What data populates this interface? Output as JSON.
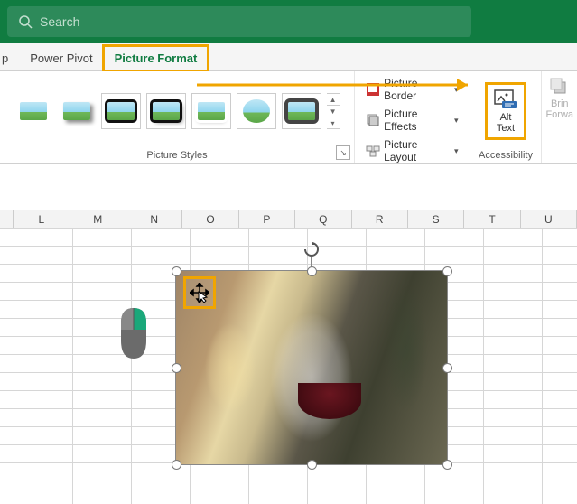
{
  "titlebar": {
    "search_placeholder": "Search"
  },
  "tabs": {
    "help": "p",
    "power_pivot": "Power Pivot",
    "picture_format": "Picture Format"
  },
  "ribbon": {
    "styles_label": "Picture Styles",
    "pic_border": "Picture Border",
    "pic_effects": "Picture Effects",
    "pic_layout": "Picture Layout",
    "alt_text_line1": "Alt",
    "alt_text_line2": "Text",
    "accessibility_label": "Accessibility",
    "bring_forward_line1": "Brin",
    "bring_forward_line2": "Forwa"
  },
  "columns": [
    "L",
    "M",
    "N",
    "O",
    "P",
    "Q",
    "R",
    "S",
    "T",
    "U"
  ]
}
